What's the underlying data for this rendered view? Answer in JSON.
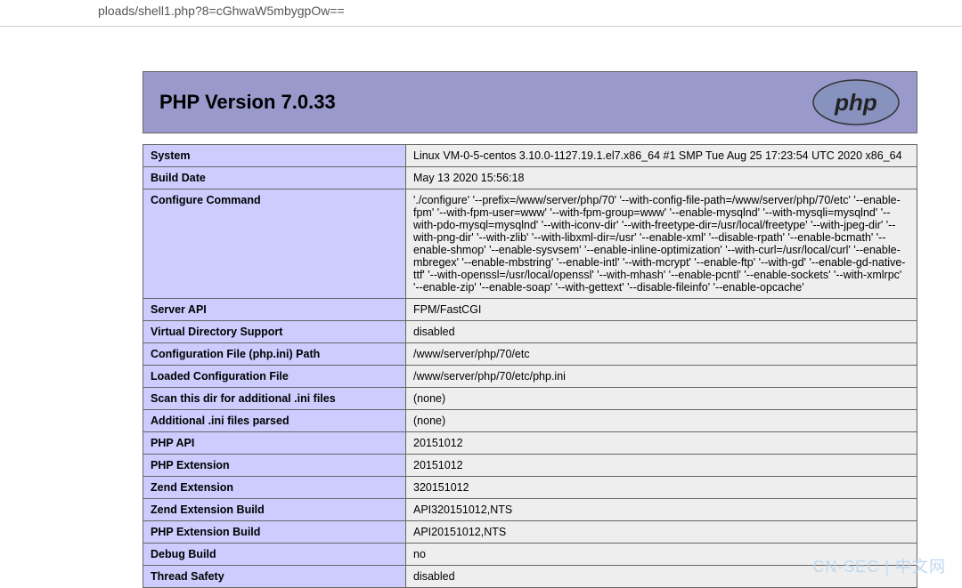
{
  "url_fragment": "ploads/shell1.php?8=cGhwaW5mbygpOw==",
  "header_title": "PHP Version 7.0.33",
  "rows": [
    {
      "key": "System",
      "val": "Linux VM-0-5-centos 3.10.0-1127.19.1.el7.x86_64 #1 SMP Tue Aug 25 17:23:54 UTC 2020 x86_64"
    },
    {
      "key": "Build Date",
      "val": "May 13 2020 15:56:18"
    },
    {
      "key": "Configure Command",
      "val": "'./configure' '--prefix=/www/server/php/70' '--with-config-file-path=/www/server/php/70/etc' '--enable-fpm' '--with-fpm-user=www' '--with-fpm-group=www' '--enable-mysqlnd' '--with-mysqli=mysqlnd' '--with-pdo-mysql=mysqlnd' '--with-iconv-dir' '--with-freetype-dir=/usr/local/freetype' '--with-jpeg-dir' '--with-png-dir' '--with-zlib' '--with-libxml-dir=/usr' '--enable-xml' '--disable-rpath' '--enable-bcmath' '--enable-shmop' '--enable-sysvsem' '--enable-inline-optimization' '--with-curl=/usr/local/curl' '--enable-mbregex' '--enable-mbstring' '--enable-intl' '--with-mcrypt' '--enable-ftp' '--with-gd' '--enable-gd-native-ttf' '--with-openssl=/usr/local/openssl' '--with-mhash' '--enable-pcntl' '--enable-sockets' '--with-xmlrpc' '--enable-zip' '--enable-soap' '--with-gettext' '--disable-fileinfo' '--enable-opcache'"
    },
    {
      "key": "Server API",
      "val": "FPM/FastCGI"
    },
    {
      "key": "Virtual Directory Support",
      "val": "disabled"
    },
    {
      "key": "Configuration File (php.ini) Path",
      "val": "/www/server/php/70/etc"
    },
    {
      "key": "Loaded Configuration File",
      "val": "/www/server/php/70/etc/php.ini"
    },
    {
      "key": "Scan this dir for additional .ini files",
      "val": "(none)"
    },
    {
      "key": "Additional .ini files parsed",
      "val": "(none)"
    },
    {
      "key": "PHP API",
      "val": "20151012"
    },
    {
      "key": "PHP Extension",
      "val": "20151012"
    },
    {
      "key": "Zend Extension",
      "val": "320151012"
    },
    {
      "key": "Zend Extension Build",
      "val": "API320151012,NTS"
    },
    {
      "key": "PHP Extension Build",
      "val": "API20151012,NTS"
    },
    {
      "key": "Debug Build",
      "val": "no"
    },
    {
      "key": "Thread Safety",
      "val": "disabled"
    }
  ],
  "watermark": "CN-SEC | 中文网"
}
